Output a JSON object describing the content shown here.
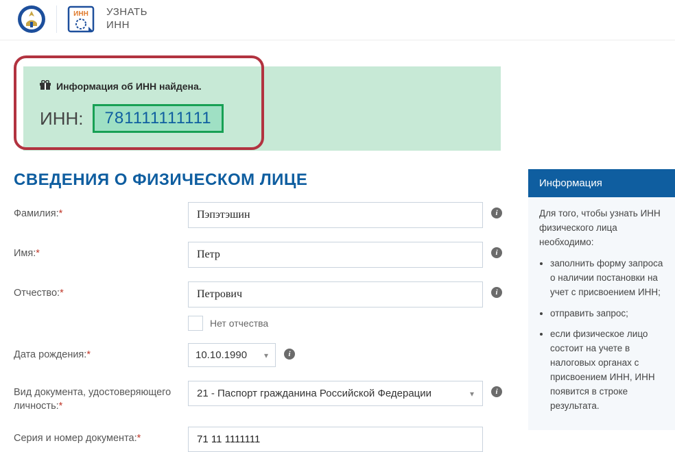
{
  "header": {
    "title_line1": "УЗНАТЬ",
    "title_line2": "ИНН",
    "logo_badge_text": "ИНН"
  },
  "result": {
    "found_text": "Информация об ИНН найдена.",
    "label": "ИНН:",
    "value": "781111111111"
  },
  "section_title": "СВЕДЕНИЯ О ФИЗИЧЕСКОМ ЛИЦЕ",
  "form": {
    "surname_label": "Фамилия:",
    "surname_value": "Пэпэтэшин",
    "name_label": "Имя:",
    "name_value": "Петр",
    "patronymic_label": "Отчество:",
    "patronymic_value": "Петрович",
    "no_patronymic_label": "Нет отчества",
    "dob_label": "Дата рождения:",
    "dob_value": "10.10.1990",
    "doc_type_label": "Вид документа, удостоверяющего личность:",
    "doc_type_value": "21 - Паспорт гражданина Российской Федерации",
    "doc_number_label": "Серия и номер документа:",
    "doc_number_value": "71 11 1111111",
    "required_mark": "*"
  },
  "info_panel": {
    "header": "Информация",
    "intro": "Для того, чтобы узнать ИНН физического лица необходимо:",
    "bullets": [
      "заполнить форму запроса о наличии постановки на учет с присвоением ИНН;",
      "отправить запрос;",
      "если физическое лицо состоит на учете в налоговых органах с присвоением ИНН, ИНН появится в строке результата."
    ]
  }
}
